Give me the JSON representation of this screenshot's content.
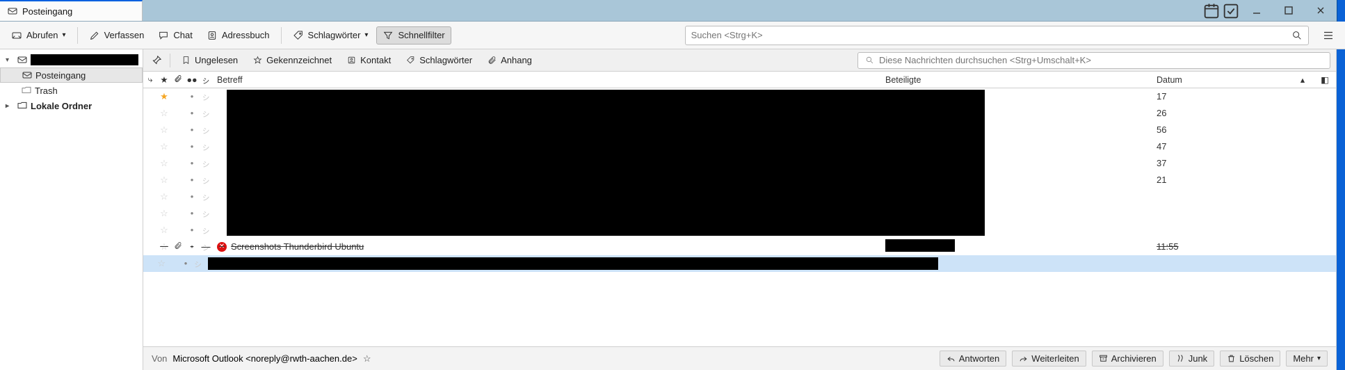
{
  "tab": {
    "title": "Posteingang"
  },
  "toolbar": {
    "get": "Abrufen",
    "write": "Verfassen",
    "chat": "Chat",
    "address": "Adressbuch",
    "tags": "Schlagwörter",
    "quickfilter": "Schnellfilter"
  },
  "search": {
    "placeholder": "Suchen <Strg+K>"
  },
  "folders": {
    "inbox": "Posteingang",
    "trash": "Trash",
    "local": "Lokale Ordner"
  },
  "qfilter": {
    "unread": "Ungelesen",
    "flagged": "Gekennzeichnet",
    "contact": "Kontakt",
    "tags": "Schlagwörter",
    "attach": "Anhang",
    "placeholder": "Diese Nachrichten durchsuchen <Strg+Umschalt+K>"
  },
  "columns": {
    "subject": "Betreff",
    "participants": "Beteiligte",
    "date": "Datum"
  },
  "rows": {
    "t0": "17",
    "t1": "26",
    "t2": "56",
    "t3": "47",
    "t4": "37",
    "t5": "21",
    "deleted_subject": "Screenshots Thunderbird Ubuntu",
    "deleted_time": "11:55"
  },
  "preview": {
    "from_label": "Von",
    "from_value": "Microsoft Outlook <noreply@rwth-aachen.de>",
    "reply": "Antworten",
    "forward": "Weiterleiten",
    "archive": "Archivieren",
    "junk": "Junk",
    "delete": "Löschen",
    "more": "Mehr"
  }
}
